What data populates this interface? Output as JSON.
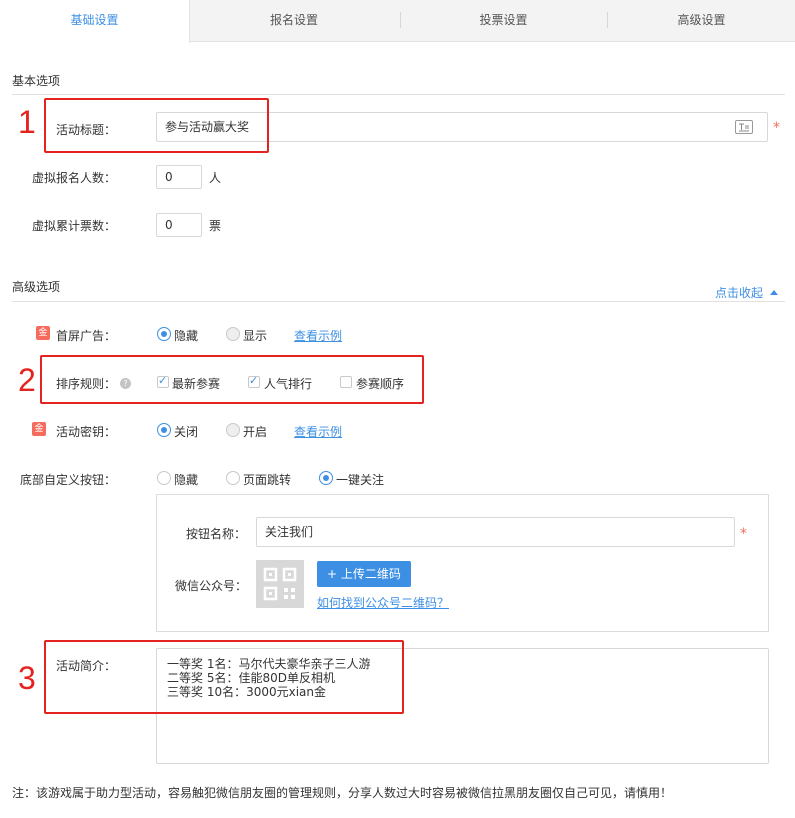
{
  "tabs": [
    {
      "label": "基础设置",
      "active": true
    },
    {
      "label": "报名设置",
      "active": false
    },
    {
      "label": "投票设置",
      "active": false
    },
    {
      "label": "高级设置",
      "active": false
    }
  ],
  "basic": {
    "section_title": "基本选项",
    "activity_title_label": "活动标题：",
    "activity_title_value": "参与活动赢大奖",
    "virtual_signup_label": "虚拟报名人数：",
    "virtual_signup_value": "0",
    "virtual_signup_unit": "人",
    "virtual_votes_label": "虚拟累计票数：",
    "virtual_votes_value": "0",
    "virtual_votes_unit": "票"
  },
  "advanced": {
    "section_title": "高级选项",
    "collapse_label": "点击收起",
    "splash_ad": {
      "badge": "金",
      "label": "首屏广告：",
      "options": [
        "隐藏",
        "显示"
      ],
      "selected": "隐藏",
      "example_link": "查看示例"
    },
    "sort_rules": {
      "label": "排序规则：",
      "help": "?",
      "options": [
        {
          "label": "最新参赛",
          "checked": true
        },
        {
          "label": "人气排行",
          "checked": true
        },
        {
          "label": "参赛顺序",
          "checked": false
        }
      ]
    },
    "activity_key": {
      "badge": "金",
      "label": "活动密钥：",
      "options": [
        "关闭",
        "开启"
      ],
      "selected": "关闭",
      "example_link": "查看示例"
    },
    "bottom_button": {
      "label": "底部自定义按钮：",
      "options": [
        "隐藏",
        "页面跳转",
        "一键关注"
      ],
      "selected": "一键关注",
      "button_name_label": "按钮名称：",
      "button_name_value": "关注我们",
      "wechat_label": "微信公众号：",
      "upload_label": "上传二维码",
      "find_qr_link": "如何找到公众号二维码？"
    },
    "intro": {
      "label": "活动简介：",
      "lines": [
        "一等奖 1名：马尔代夫豪华亲子三人游",
        "二等奖 5名：佳能80D单反相机",
        "三等奖 10名：3000元xian金"
      ]
    }
  },
  "annotations": [
    "1",
    "2",
    "3"
  ],
  "note": "注：该游戏属于助力型活动，容易触犯微信朋友圈的管理规则，分享人数过大时容易被微信拉黑朋友圈仅自己可见，请慎用！",
  "colors": {
    "accent": "#3d8fe3",
    "annotation_red": "#e4231e",
    "required": "#f56c5f"
  }
}
